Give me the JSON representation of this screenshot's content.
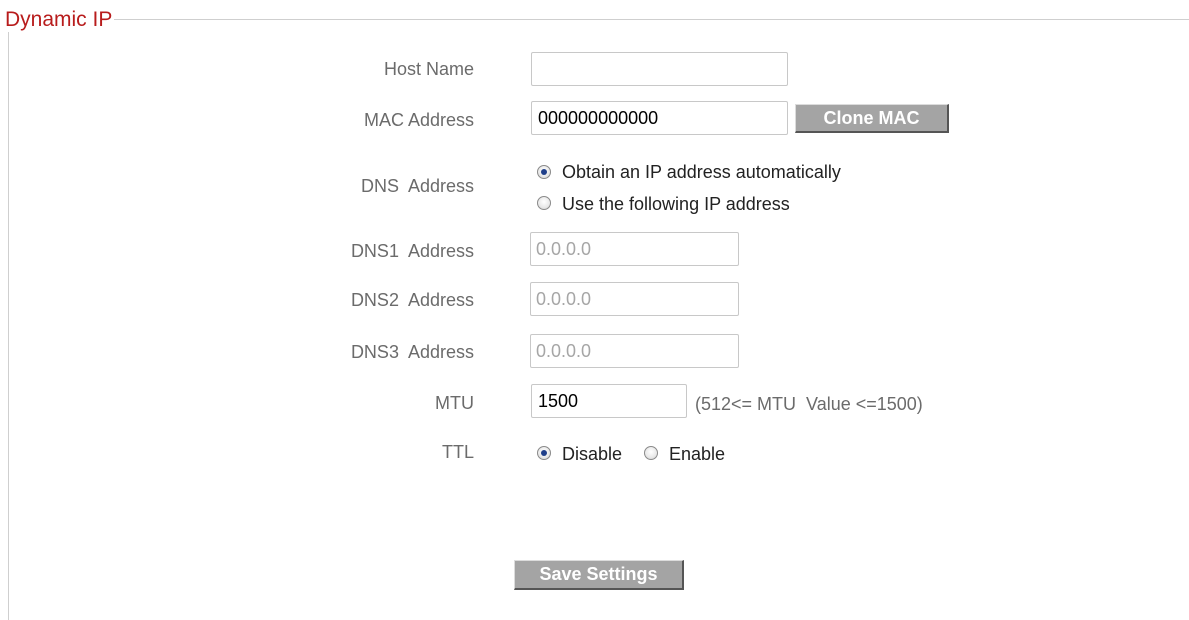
{
  "section": {
    "legend": "Dynamic IP"
  },
  "fields": {
    "host_name": {
      "label": "Host Name",
      "value": ""
    },
    "mac_address": {
      "label": "MAC Address",
      "value": "000000000000",
      "clone_button": "Clone MAC"
    },
    "dns_address": {
      "label": "DNS  Address",
      "option_auto": "Obtain an IP address automatically",
      "option_manual": "Use the following IP address",
      "selected": "auto"
    },
    "dns1": {
      "label": "DNS1  Address",
      "value": "0.0.0.0"
    },
    "dns2": {
      "label": "DNS2  Address",
      "value": "0.0.0.0"
    },
    "dns3": {
      "label": "DNS3  Address",
      "value": "0.0.0.0"
    },
    "mtu": {
      "label": "MTU",
      "value": "1500",
      "hint": "(512<= MTU  Value <=1500)"
    },
    "ttl": {
      "label": "TTL",
      "option_disable": "Disable",
      "option_enable": "Enable",
      "selected": "disable"
    }
  },
  "actions": {
    "save_label": "Save Settings"
  },
  "colors": {
    "legend": "#b81c1c",
    "label": "#6b6b6b",
    "button_bg": "#a4a4a4",
    "radio_dot": "#1f3f8a"
  }
}
